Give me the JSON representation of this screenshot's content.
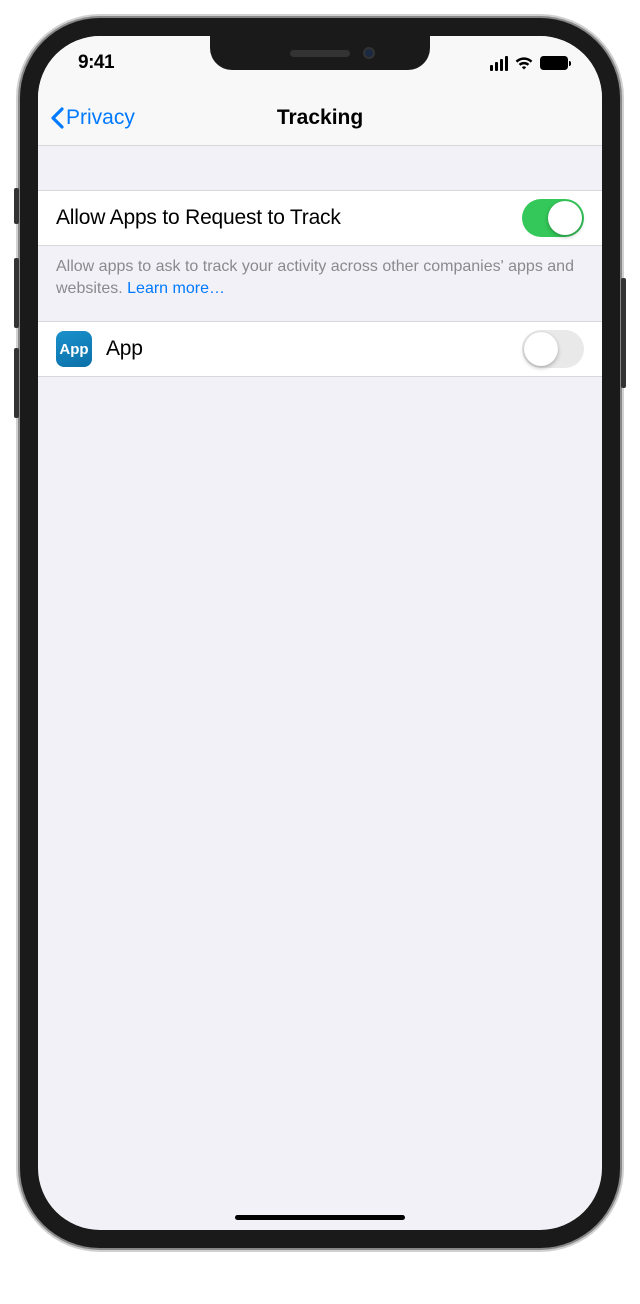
{
  "status": {
    "time": "9:41"
  },
  "nav": {
    "back_label": "Privacy",
    "title": "Tracking"
  },
  "main_toggle": {
    "label": "Allow Apps to Request to Track",
    "on": true
  },
  "footer": {
    "text": "Allow apps to ask to track your activity across other companies' apps and websites. ",
    "link_text": "Learn more…"
  },
  "apps": [
    {
      "icon_text": "App",
      "name": "App",
      "on": false
    }
  ]
}
